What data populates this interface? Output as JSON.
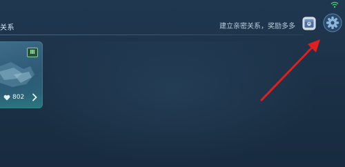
{
  "header": {
    "title": "关系",
    "hint": "建立亲密关系，奖励多多"
  },
  "card": {
    "badge": "Ⅲ",
    "intimacy_value": "802"
  },
  "icons": {
    "wifi": "wifi-icon",
    "reward": "reward-chest-icon",
    "settings": "gear-icon",
    "heart": "heart-icon",
    "chevron": "chevron-right-icon",
    "handshake": "handshake-icon"
  },
  "colors": {
    "background": "#1c3248",
    "annotation_arrow": "#e01f1f",
    "wifi": "#3fd46a"
  }
}
